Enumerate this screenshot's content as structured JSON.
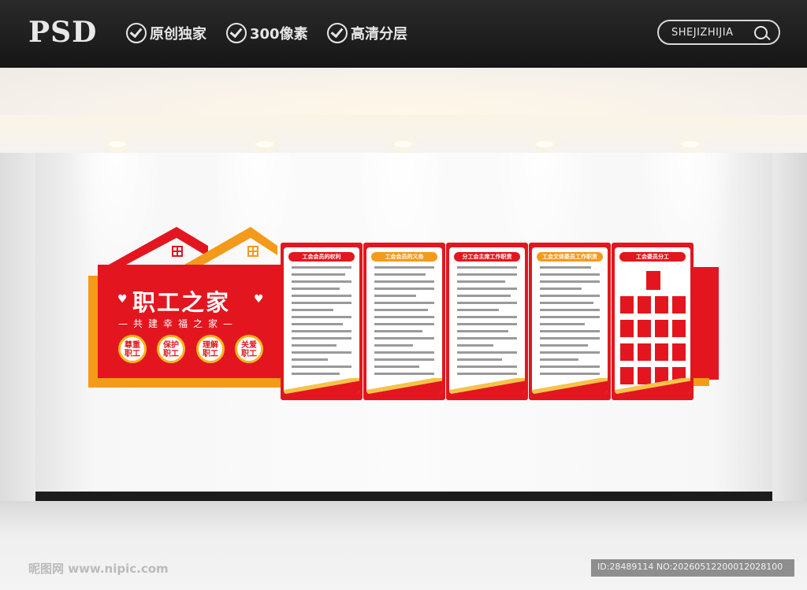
{
  "header": {
    "logo": "PSD",
    "badges": [
      "原创独家",
      "300像素",
      "高清分层"
    ],
    "search_label": "SHEJIZHIJIA"
  },
  "display": {
    "title": "职工之家",
    "subtitle": "共建幸福之家",
    "circles": [
      {
        "l1": "尊重",
        "l2": "职工"
      },
      {
        "l1": "保护",
        "l2": "职工"
      },
      {
        "l1": "理解",
        "l2": "职工"
      },
      {
        "l1": "关爱",
        "l2": "职工"
      }
    ],
    "panels": [
      {
        "header": "工会会员的权利"
      },
      {
        "header": "工会会员的义务"
      },
      {
        "header": "分工会主席工作职责"
      },
      {
        "header": "工会文体委员工作职责"
      },
      {
        "header": "工会委员分工"
      }
    ]
  },
  "watermark": {
    "site": "昵图网 www.nipic.com",
    "id_text": "ID:28489114 NO:20260512200012028100"
  },
  "colors": {
    "red": "#e3161f",
    "orange": "#f49a1a",
    "gold": "#f5c34a"
  }
}
